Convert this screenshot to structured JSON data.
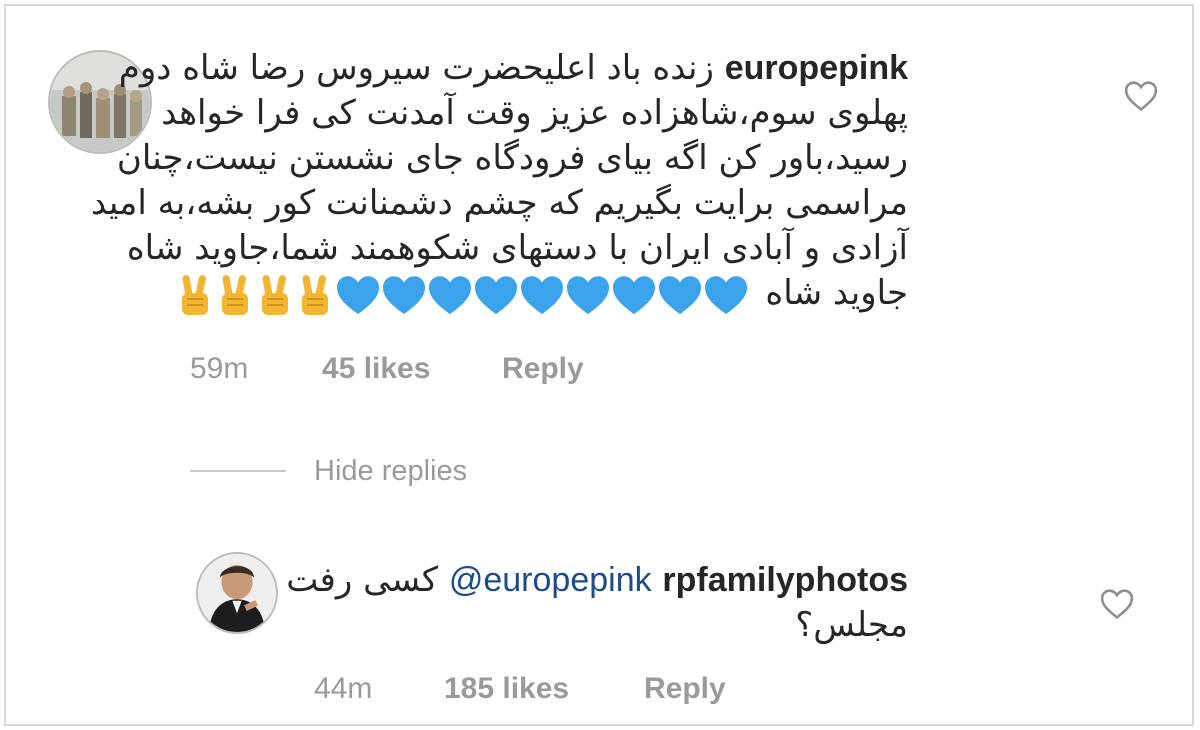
{
  "comments": [
    {
      "username": "europepink",
      "lines": [
        "زنده باد اعلیحضرت سیروس رضا شاه دوم",
        "پهلوی سوم،شاهزاده عزیز وقت آمدنت کی فرا خواهد",
        "رسید،باور کن اگه بیای فرودگاه جای نشستن نیست،چنان",
        "مراسمی برایت بگیریم که چشم دشمنانت کور بشه،به امید",
        "آزادی و آبادی ایران با دستهای شکوهمند شما،جاوید شاه",
        "جاوید شاه"
      ],
      "emojis": {
        "heart_icon": "blue-heart-icon",
        "heart_color": "#3aa3ec",
        "heart_count": 9,
        "victory_icon": "victory-hand-icon",
        "victory_color": "#f2b632",
        "victory_count": 4
      },
      "time": "59m",
      "likes": "45 likes",
      "reply": "Reply"
    },
    {
      "username": "rpfamilyphotos",
      "mention": "@europepink",
      "lines": [
        "کسی رفت",
        "مجلس؟"
      ],
      "time": "44m",
      "likes": "185 likes",
      "reply": "Reply"
    }
  ],
  "thread": {
    "hide_replies": "Hide replies"
  },
  "icons": {
    "like": "heart-outline-icon"
  }
}
